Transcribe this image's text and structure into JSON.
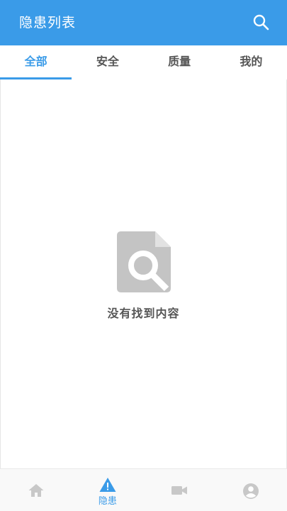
{
  "appbar": {
    "title": "隐患列表",
    "search_icon": "search-icon"
  },
  "tabs": [
    {
      "label": "全部",
      "active": true
    },
    {
      "label": "安全",
      "active": false
    },
    {
      "label": "质量",
      "active": false
    },
    {
      "label": "我的",
      "active": false
    }
  ],
  "empty_state": {
    "icon": "file-search-icon",
    "message": "没有找到内容"
  },
  "bottom_nav": {
    "items": [
      {
        "icon": "home-icon",
        "label": "",
        "active": false
      },
      {
        "icon": "warning-icon",
        "label": "隐患",
        "active": true
      },
      {
        "icon": "video-camera-icon",
        "label": "",
        "active": false
      },
      {
        "icon": "account-circle-icon",
        "label": "",
        "active": false
      }
    ]
  },
  "colors": {
    "primary": "#3a9be8",
    "tab_text": "#555555",
    "icon_inactive": "#c8c8c8",
    "empty_icon": "#c4c4c4"
  }
}
